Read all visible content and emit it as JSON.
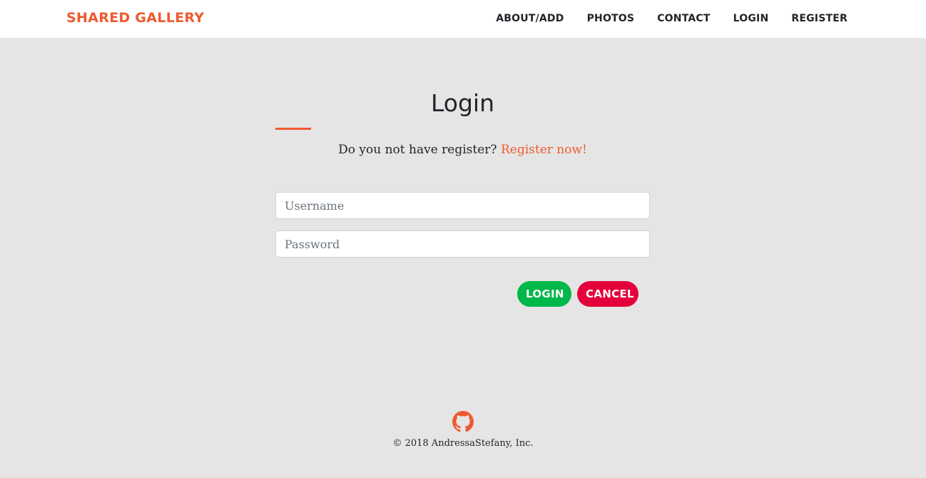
{
  "nav": {
    "brand": "SHARED GALLERY",
    "links": [
      "ABOUT/ADD",
      "PHOTOS",
      "CONTACT",
      "LOGIN",
      "REGISTER"
    ]
  },
  "login": {
    "title": "Login",
    "prompt_text": "Do you not have register?",
    "register_link": "Register now!",
    "username_placeholder": "Username",
    "username_value": "",
    "password_placeholder": "Password",
    "password_value": "",
    "login_button": "LOGIN",
    "cancel_button": "CANCEL"
  },
  "footer": {
    "icon": "github-icon",
    "copyright": "© 2018 AndressaStefany, Inc."
  },
  "colors": {
    "accent": "#ee5a2f",
    "login_button": "#00b74a",
    "cancel_button": "#e4003a",
    "background": "#e5e5e5"
  }
}
